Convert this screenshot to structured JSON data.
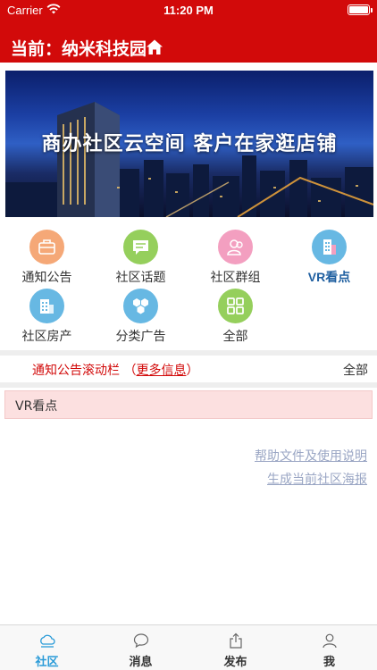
{
  "status_bar": {
    "carrier": "Carrier",
    "time": "11:20 PM"
  },
  "nav": {
    "title": "当前：纳米科技园",
    "home_icon": "home-icon"
  },
  "banner": {
    "slogan": "商办社区云空间 客户在家逛店铺"
  },
  "grid": [
    {
      "label": "通知公告",
      "icon": "notice-icon",
      "color": "#f5a877"
    },
    {
      "label": "社区话题",
      "icon": "topic-icon",
      "color": "#95cf5c"
    },
    {
      "label": "社区群组",
      "icon": "group-icon",
      "color": "#f39fc0"
    },
    {
      "label": "VR看点",
      "icon": "vr-building-icon",
      "color": "#67b8e3"
    },
    {
      "label": "社区房产",
      "icon": "property-icon",
      "color": "#67b8e3"
    },
    {
      "label": "分类广告",
      "icon": "ads-icon",
      "color": "#67b8e3"
    },
    {
      "label": "全部",
      "icon": "all-grid-icon",
      "color": "#95cf5c"
    }
  ],
  "ticker": {
    "text": "通知公告滚动栏 （",
    "more": "更多信息",
    "close": "）",
    "all": "全部"
  },
  "section": {
    "title": "VR看点"
  },
  "links": {
    "help": "帮助文件及使用说明",
    "poster": "生成当前社区海报"
  },
  "tabs": [
    {
      "label": "社区",
      "icon": "community-icon",
      "active": true
    },
    {
      "label": "消息",
      "icon": "message-icon",
      "active": false
    },
    {
      "label": "发布",
      "icon": "publish-icon",
      "active": false
    },
    {
      "label": "我",
      "icon": "profile-icon",
      "active": false
    }
  ],
  "colors": {
    "brand_red": "#d20a0a",
    "tab_active": "#2a9bd8",
    "link": "#9aa6c4"
  }
}
